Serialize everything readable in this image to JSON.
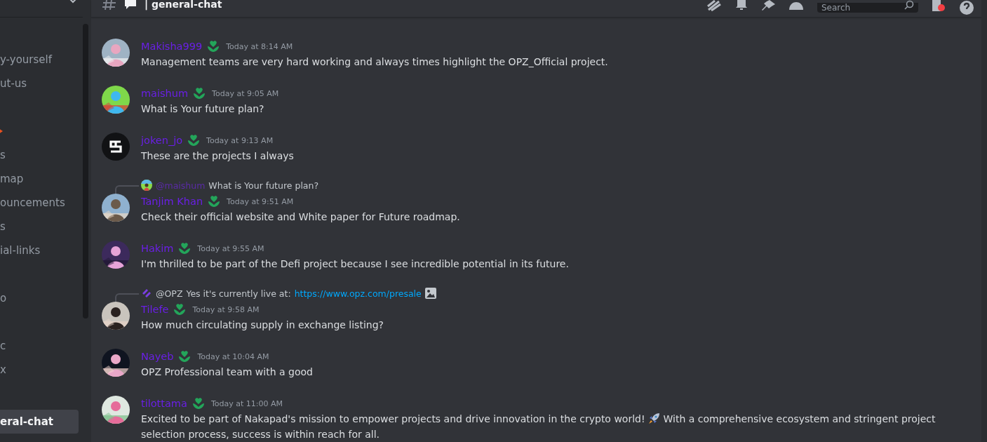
{
  "header": {
    "title": "| general-chat",
    "search": {
      "placeholder": "Search"
    },
    "inbox_unread": true
  },
  "sidebar": {
    "items": [
      {
        "kind": "channel",
        "label": "y-yourself",
        "selected": false
      },
      {
        "kind": "channel",
        "label": "ut-us",
        "selected": false
      },
      {
        "kind": "icon",
        "selected": false
      },
      {
        "kind": "channel",
        "label": "s",
        "selected": false
      },
      {
        "kind": "channel",
        "label": "map",
        "selected": false
      },
      {
        "kind": "channel",
        "label": "ouncements",
        "selected": false
      },
      {
        "kind": "channel",
        "label": "s",
        "selected": false
      },
      {
        "kind": "channel",
        "label": "ial-links",
        "selected": false
      },
      {
        "kind": "channel",
        "label": "o",
        "selected": false
      },
      {
        "kind": "channel",
        "label": "c",
        "selected": false
      },
      {
        "kind": "channel",
        "label": "x",
        "selected": false
      },
      {
        "kind": "channel",
        "label": "eral-chat",
        "selected": true
      }
    ]
  },
  "messages": [
    {
      "author": "Makisha999",
      "time": "Today at 8:14 AM",
      "avatar": {
        "kind": "picture"
      },
      "text": [
        [
          "Management teams are very hard working and always times highlight the OPZ_Official project."
        ]
      ]
    },
    {
      "author": "maishum",
      "time": "Today at 9:05 AM",
      "avatar": {
        "kind": "picture"
      },
      "text": [
        [
          "What is Your future plan?"
        ]
      ]
    },
    {
      "author": "joken_jo",
      "time": "Today at 9:13 AM",
      "avatar": {
        "kind": "logo"
      },
      "text": [
        [
          "These are the projects I always"
        ]
      ]
    },
    {
      "author": "Tanjim Khan",
      "time": "Today at 9:51 AM",
      "avatar": {
        "kind": "picture"
      },
      "reply": {
        "avatar": {
          "kind": "picture"
        },
        "mention": "@maishum",
        "color": "#5a2ba6",
        "text": "What is Your future plan?"
      },
      "text": [
        [
          "Check their official website and White paper for Future roadmap."
        ]
      ]
    },
    {
      "author": "Hakim",
      "time": "Today at 9:55 AM",
      "avatar": {
        "kind": "picture"
      },
      "text": [
        [
          "I'm thrilled to be part of the Defi project because I see incredible potential in its future."
        ]
      ]
    },
    {
      "author": "Tilefe",
      "time": "Today at 9:58 AM",
      "avatar": {
        "kind": "picture"
      },
      "reply": {
        "avatar": {
          "kind": "logo"
        },
        "mention": "@OPZ",
        "color": "#c4c9ce",
        "text": "Yes it's currently live at:",
        "link": "https://www.opz.com/presale",
        "attachment": true
      },
      "text": [
        [
          "How much circulating supply in exchange listing?"
        ]
      ]
    },
    {
      "author": "Nayeb",
      "time": "Today at 10:04 AM",
      "avatar": {
        "kind": "picture"
      },
      "text": [
        [
          "OPZ Professional team with a good"
        ]
      ]
    },
    {
      "author": "tilottama",
      "time": "Today at 11:00 AM",
      "avatar": {
        "kind": "picture"
      },
      "text": [
        [
          "Excited to be part of Nakapad's mission to empower projects and drive innovation in the crypto world!",
          "With a comprehensive ecosystem and stringent project"
        ],
        [
          "selection process, success is within reach for all."
        ]
      ]
    }
  ]
}
